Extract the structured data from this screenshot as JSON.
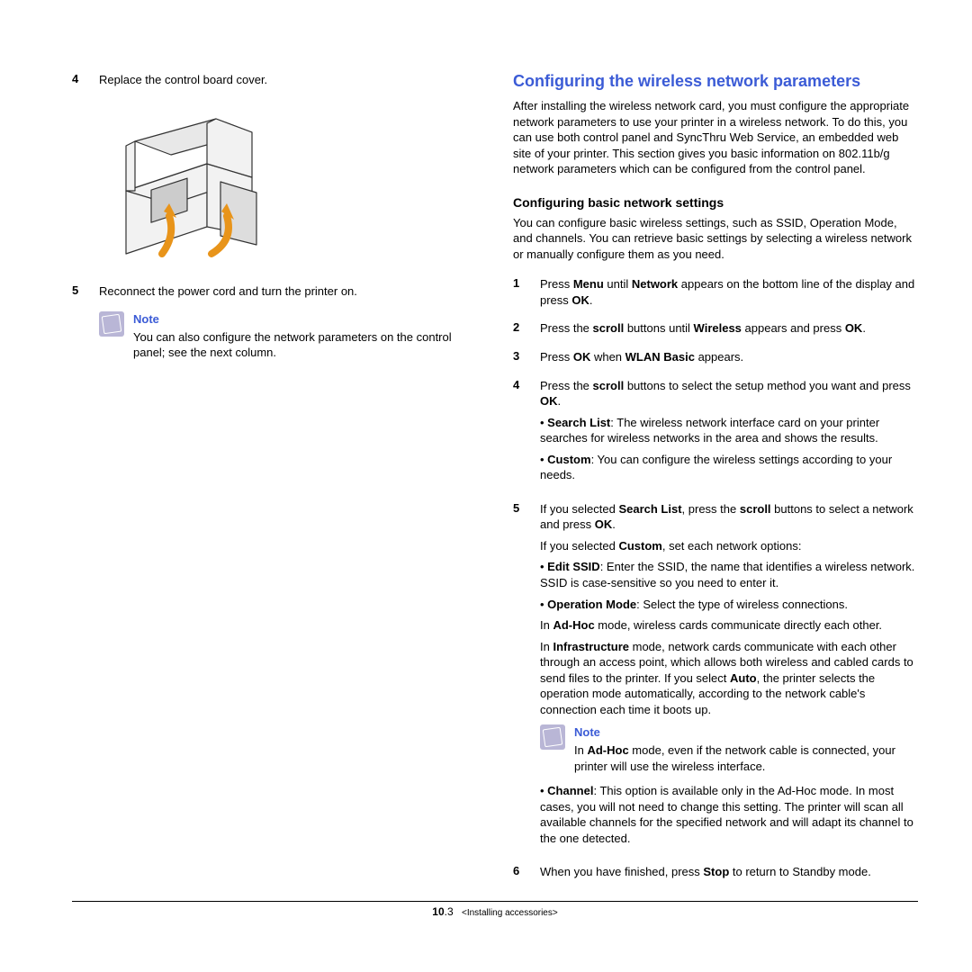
{
  "left": {
    "step4_num": "4",
    "step4_text": "Replace the control board cover.",
    "step5_num": "5",
    "step5_text": "Reconnect the power cord and turn the printer on.",
    "note_label": "Note",
    "note_text": "You can also configure the network parameters on the control panel; see the next column."
  },
  "right": {
    "title": "Configuring the wireless network parameters",
    "intro": "After installing the wireless network card, you must configure the appropriate network parameters to use your printer in a wireless network. To do this, you can use both control panel and SyncThru Web Service, an embedded web site of your printer. This section gives you basic information on 802.11b/g network parameters which can be configured from the control panel.",
    "sub_title": "Configuring basic network settings",
    "sub_intro": "You can configure basic wireless settings, such as SSID, Operation Mode, and channels. You can retrieve basic settings by selecting a wireless network or manually configure them as you need.",
    "s1_num": "1",
    "s1_a": "Press ",
    "s1_b": "Menu",
    "s1_c": " until ",
    "s1_d": "Network",
    "s1_e": " appears on the bottom line of the display and press ",
    "s1_f": "OK",
    "s1_g": ".",
    "s2_num": "2",
    "s2_a": "Press the ",
    "s2_b": "scroll",
    "s2_c": " buttons until ",
    "s2_d": "Wireless",
    "s2_e": " appears and press ",
    "s2_f": "OK",
    "s2_g": ".",
    "s3_num": "3",
    "s3_a": "Press ",
    "s3_b": "OK",
    "s3_c": " when ",
    "s3_d": "WLAN Basic",
    "s3_e": " appears.",
    "s4_num": "4",
    "s4_a": "Press the ",
    "s4_b": "scroll",
    "s4_c": " buttons to select the setup method you want and press ",
    "s4_d": "OK",
    "s4_e": ".",
    "s4_bl1_lead": "Search List",
    "s4_bl1_text": ": The wireless network interface card on your printer searches for wireless networks in the area and shows the results.",
    "s4_bl2_lead": "Custom",
    "s4_bl2_text": ": You can configure the wireless settings according to your needs.",
    "s5_num": "5",
    "s5_a": "If you selected ",
    "s5_b": "Search List",
    "s5_c": ", press the ",
    "s5_d": "scroll",
    "s5_e": " buttons to select a network and press ",
    "s5_f": "OK",
    "s5_g": ".",
    "s5_p2a": "If you selected ",
    "s5_p2b": "Custom",
    "s5_p2c": ", set each network options:",
    "s5_bl1_lead": "Edit SSID",
    "s5_bl1_text": ": Enter the SSID, the name that identifies a wireless network. SSID is case-sensitive so you need to enter it.",
    "s5_bl2_lead": "Operation Mode",
    "s5_bl2_text": ": Select the type of wireless connections.",
    "s5_p3a": "In ",
    "s5_p3b": "Ad-Hoc",
    "s5_p3c": " mode, wireless cards communicate directly each other.",
    "s5_p4a": "In ",
    "s5_p4b": "Infrastructure",
    "s5_p4c": " mode, network cards communicate with each other through an access point, which allows both wireless and cabled cards to send files to the printer. If you select ",
    "s5_p4d": "Auto",
    "s5_p4e": ", the printer selects the operation mode automatically, according to the network cable's connection each time it boots up.",
    "note2_label": "Note",
    "note2_a": "In ",
    "note2_b": "Ad-Hoc",
    "note2_c": " mode, even if the network cable is connected, your printer will use the wireless interface.",
    "s5_bl3_lead": "Channel",
    "s5_bl3_text": ": This option is available only in the Ad-Hoc mode. In most cases, you will not need to change this setting. The printer will scan all available channels for the specified network and will adapt its channel to the one detected.",
    "s6_num": "6",
    "s6_a": "When you have finished, press ",
    "s6_b": "Stop",
    "s6_c": " to return to Standby mode."
  },
  "footer": {
    "chap": "10",
    "sub": ".3",
    "label": "<Installing accessories>"
  }
}
